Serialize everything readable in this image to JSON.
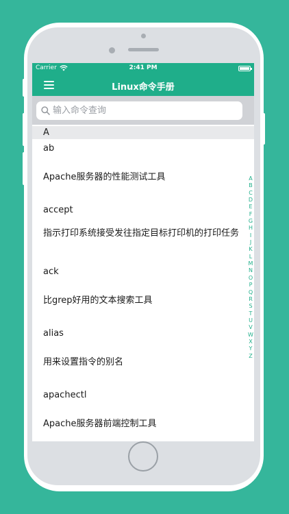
{
  "status_bar": {
    "carrier": "Carrier",
    "time": "2:41 PM"
  },
  "nav": {
    "title": "Linux命令手册",
    "menu_icon": "hamburger-menu-icon"
  },
  "search": {
    "placeholder": "输入命令查询",
    "value": ""
  },
  "section": {
    "header": "A"
  },
  "list": [
    "ab",
    "Apache服务器的性能测试工具",
    "accept",
    "指示打印系统接受发往指定目标打印机的打印任务",
    "ack",
    "比grep好用的文本搜索工具",
    "alias",
    "用来设置指令的别名",
    "apachectl",
    "Apache服务器前端控制工具"
  ],
  "index": [
    "A",
    "B",
    "C",
    "D",
    "E",
    "F",
    "G",
    "H",
    "I",
    "J",
    "K",
    "L",
    "M",
    "N",
    "O",
    "P",
    "Q",
    "R",
    "S",
    "T",
    "U",
    "V",
    "W",
    "X",
    "Y",
    "Z"
  ],
  "colors": {
    "background": "#35b69b",
    "accent": "#1fae8a",
    "section_header": "#e8e9eb"
  }
}
